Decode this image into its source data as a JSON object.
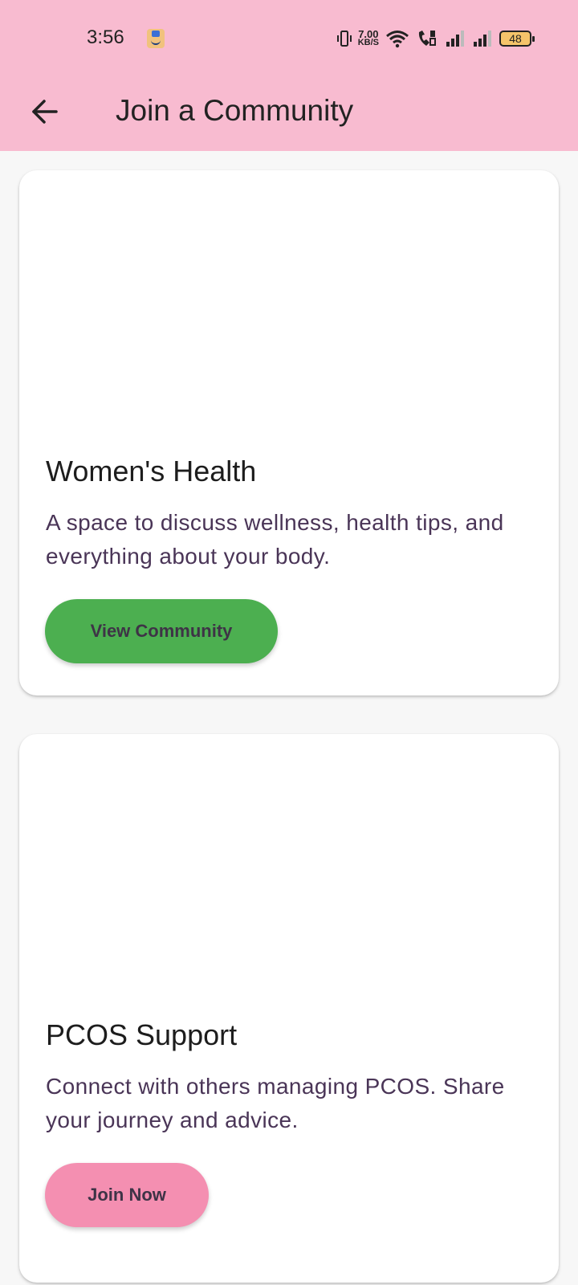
{
  "status_bar": {
    "time": "3:56",
    "net_speed_value": "7.00",
    "net_speed_unit": "KB/S",
    "battery": "48",
    "icons": [
      "amazon-app-icon",
      "vibrate-icon",
      "wifi-icon",
      "wifi-call-icon",
      "signal-icon",
      "signal-icon",
      "battery-icon"
    ]
  },
  "app_bar": {
    "title": "Join a Community",
    "back_icon": "arrow-back-icon"
  },
  "communities": [
    {
      "title": "Women's Health",
      "description": "A space to discuss wellness, health tips, and everything about your body.",
      "button_label": "View Community",
      "button_color": "#4caf50"
    },
    {
      "title": "PCOS Support",
      "description": "Connect with others managing PCOS. Share your journey and advice.",
      "button_label": "Join Now",
      "button_color": "#f48fb1"
    }
  ],
  "colors": {
    "app_bar": "#f8bbd0",
    "background": "#f7f7f7",
    "card": "#ffffff",
    "description_text": "#4a3557"
  }
}
